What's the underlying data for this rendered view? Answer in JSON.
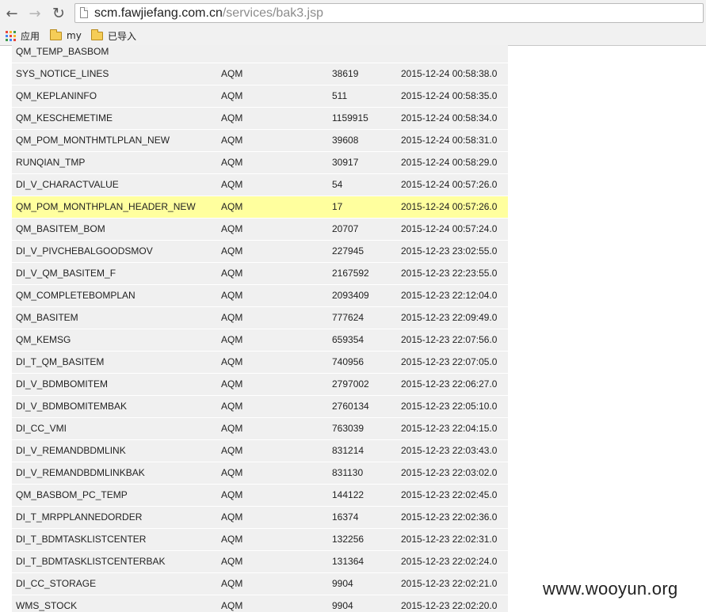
{
  "browser": {
    "back_glyph": "←",
    "forward_glyph": "→",
    "reload_glyph": "↻",
    "url_host": "scm.fawjiefang.com.cn",
    "url_path": "/services/bak3.jsp",
    "bookmarks": {
      "apps_label": "应用",
      "my_label": "my",
      "imported_label": "已导入"
    },
    "apps_grid_colors": [
      "#e8463b",
      "#f6b629",
      "#3d9a4b",
      "#4285f4",
      "#e8463b",
      "#f6b629",
      "#3d9a4b",
      "#4285f4",
      "#e8463b"
    ]
  },
  "table": {
    "highlight_color": "#ffff9e",
    "rows": [
      {
        "name": "QM_TEMP_BASBOM",
        "owner": "",
        "count": "",
        "time": ""
      },
      {
        "name": "SYS_NOTICE_LINES",
        "owner": "AQM",
        "count": "38619",
        "time": "2015-12-24 00:58:38.0"
      },
      {
        "name": "QM_KEPLANINFO",
        "owner": "AQM",
        "count": "511",
        "time": "2015-12-24 00:58:35.0"
      },
      {
        "name": "QM_KESCHEMETIME",
        "owner": "AQM",
        "count": "1159915",
        "time": "2015-12-24 00:58:34.0"
      },
      {
        "name": "QM_POM_MONTHMTLPLAN_NEW",
        "owner": "AQM",
        "count": "39608",
        "time": "2015-12-24 00:58:31.0"
      },
      {
        "name": "RUNQIAN_TMP",
        "owner": "AQM",
        "count": "30917",
        "time": "2015-12-24 00:58:29.0"
      },
      {
        "name": "DI_V_CHARACTVALUE",
        "owner": "AQM",
        "count": "54",
        "time": "2015-12-24 00:57:26.0"
      },
      {
        "name": "QM_POM_MONTHPLAN_HEADER_NEW",
        "owner": "AQM",
        "count": "17",
        "time": "2015-12-24 00:57:26.0",
        "highlight": true
      },
      {
        "name": "QM_BASITEM_BOM",
        "owner": "AQM",
        "count": "20707",
        "time": "2015-12-24 00:57:24.0"
      },
      {
        "name": "DI_V_PIVCHEBALGOODSMOV",
        "owner": "AQM",
        "count": "227945",
        "time": "2015-12-23 23:02:55.0"
      },
      {
        "name": "DI_V_QM_BASITEM_F",
        "owner": "AQM",
        "count": "2167592",
        "time": "2015-12-23 22:23:55.0"
      },
      {
        "name": "QM_COMPLETEBOMPLAN",
        "owner": "AQM",
        "count": "2093409",
        "time": "2015-12-23 22:12:04.0"
      },
      {
        "name": "QM_BASITEM",
        "owner": "AQM",
        "count": "777624",
        "time": "2015-12-23 22:09:49.0"
      },
      {
        "name": "QM_KEMSG",
        "owner": "AQM",
        "count": "659354",
        "time": "2015-12-23 22:07:56.0"
      },
      {
        "name": "DI_T_QM_BASITEM",
        "owner": "AQM",
        "count": "740956",
        "time": "2015-12-23 22:07:05.0"
      },
      {
        "name": "DI_V_BDMBOMITEM",
        "owner": "AQM",
        "count": "2797002",
        "time": "2015-12-23 22:06:27.0"
      },
      {
        "name": "DI_V_BDMBOMITEMBAK",
        "owner": "AQM",
        "count": "2760134",
        "time": "2015-12-23 22:05:10.0"
      },
      {
        "name": "DI_CC_VMI",
        "owner": "AQM",
        "count": "763039",
        "time": "2015-12-23 22:04:15.0"
      },
      {
        "name": "DI_V_REMANDBDMLINK",
        "owner": "AQM",
        "count": "831214",
        "time": "2015-12-23 22:03:43.0"
      },
      {
        "name": "DI_V_REMANDBDMLINKBAK",
        "owner": "AQM",
        "count": "831130",
        "time": "2015-12-23 22:03:02.0"
      },
      {
        "name": "QM_BASBOM_PC_TEMP",
        "owner": "AQM",
        "count": "144122",
        "time": "2015-12-23 22:02:45.0"
      },
      {
        "name": "DI_T_MRPPLANNEDORDER",
        "owner": "AQM",
        "count": "16374",
        "time": "2015-12-23 22:02:36.0"
      },
      {
        "name": "DI_T_BDMTASKLISTCENTER",
        "owner": "AQM",
        "count": "132256",
        "time": "2015-12-23 22:02:31.0"
      },
      {
        "name": "DI_T_BDMTASKLISTCENTERBAK",
        "owner": "AQM",
        "count": "131364",
        "time": "2015-12-23 22:02:24.0"
      },
      {
        "name": "DI_CC_STORAGE",
        "owner": "AQM",
        "count": "9904",
        "time": "2015-12-23 22:02:21.0"
      },
      {
        "name": "WMS_STOCK",
        "owner": "AQM",
        "count": "9904",
        "time": "2015-12-23 22:02:20.0"
      }
    ]
  },
  "watermark": "www.wooyun.org"
}
